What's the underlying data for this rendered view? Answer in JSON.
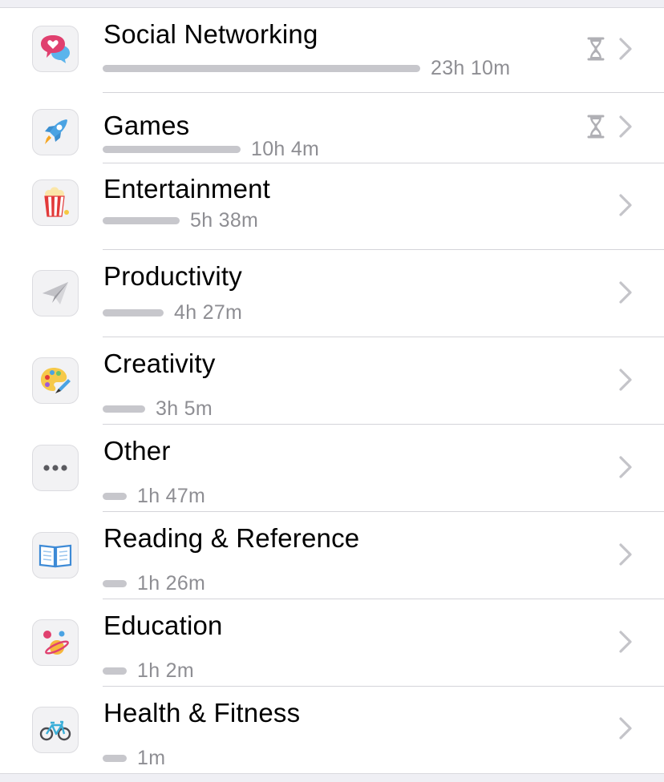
{
  "categories": [
    {
      "label": "Social Networking",
      "time": "23h 10m",
      "usage_fraction": 1.0,
      "icon": "chat-bubbles-heart-icon",
      "has_limit": true
    },
    {
      "label": "Games",
      "time": "10h 4m",
      "usage_fraction": 0.435,
      "icon": "rocket-icon",
      "has_limit": true
    },
    {
      "label": "Entertainment",
      "time": "5h 38m",
      "usage_fraction": 0.243,
      "icon": "popcorn-icon",
      "has_limit": false
    },
    {
      "label": "Productivity",
      "time": "4h 27m",
      "usage_fraction": 0.192,
      "icon": "paper-plane-icon",
      "has_limit": false
    },
    {
      "label": "Creativity",
      "time": "3h 5m",
      "usage_fraction": 0.133,
      "icon": "palette-icon",
      "has_limit": false
    },
    {
      "label": "Other",
      "time": "1h 47m",
      "usage_fraction": 0.077,
      "icon": "ellipsis-icon",
      "has_limit": false
    },
    {
      "label": "Reading & Reference",
      "time": "1h 26m",
      "usage_fraction": 0.062,
      "icon": "open-book-icon",
      "has_limit": false
    },
    {
      "label": "Education",
      "time": "1h 2m",
      "usage_fraction": 0.045,
      "icon": "planet-icon",
      "has_limit": false
    },
    {
      "label": "Health & Fitness",
      "time": "1m",
      "usage_fraction": 0.001,
      "icon": "bicycle-icon",
      "has_limit": false
    }
  ],
  "colors": {
    "bar": "#c7c7cc",
    "secondary_text": "#8e8e93",
    "chevron": "#c4c4c9",
    "hourglass": "#b0b0b5"
  }
}
